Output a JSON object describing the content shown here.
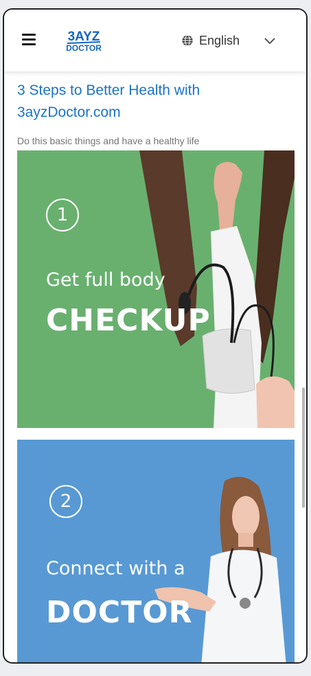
{
  "header": {
    "logo_line1": "3AYZ",
    "logo_line2": "DOCTOR",
    "language": "English"
  },
  "article": {
    "title": "3 Steps to Better Health with 3ayzDoctor.com",
    "subtitle": "Do this basic things and have a healthy life"
  },
  "steps": [
    {
      "number": "1",
      "line1": "Get full body",
      "line2": "CHECKUP",
      "color": "#69b06f"
    },
    {
      "number": "2",
      "line1": "Connect with a",
      "line2": "DOCTOR",
      "color": "#5899d4"
    }
  ],
  "colors": {
    "accent": "#1a73c7",
    "logo": "#1565c0"
  }
}
